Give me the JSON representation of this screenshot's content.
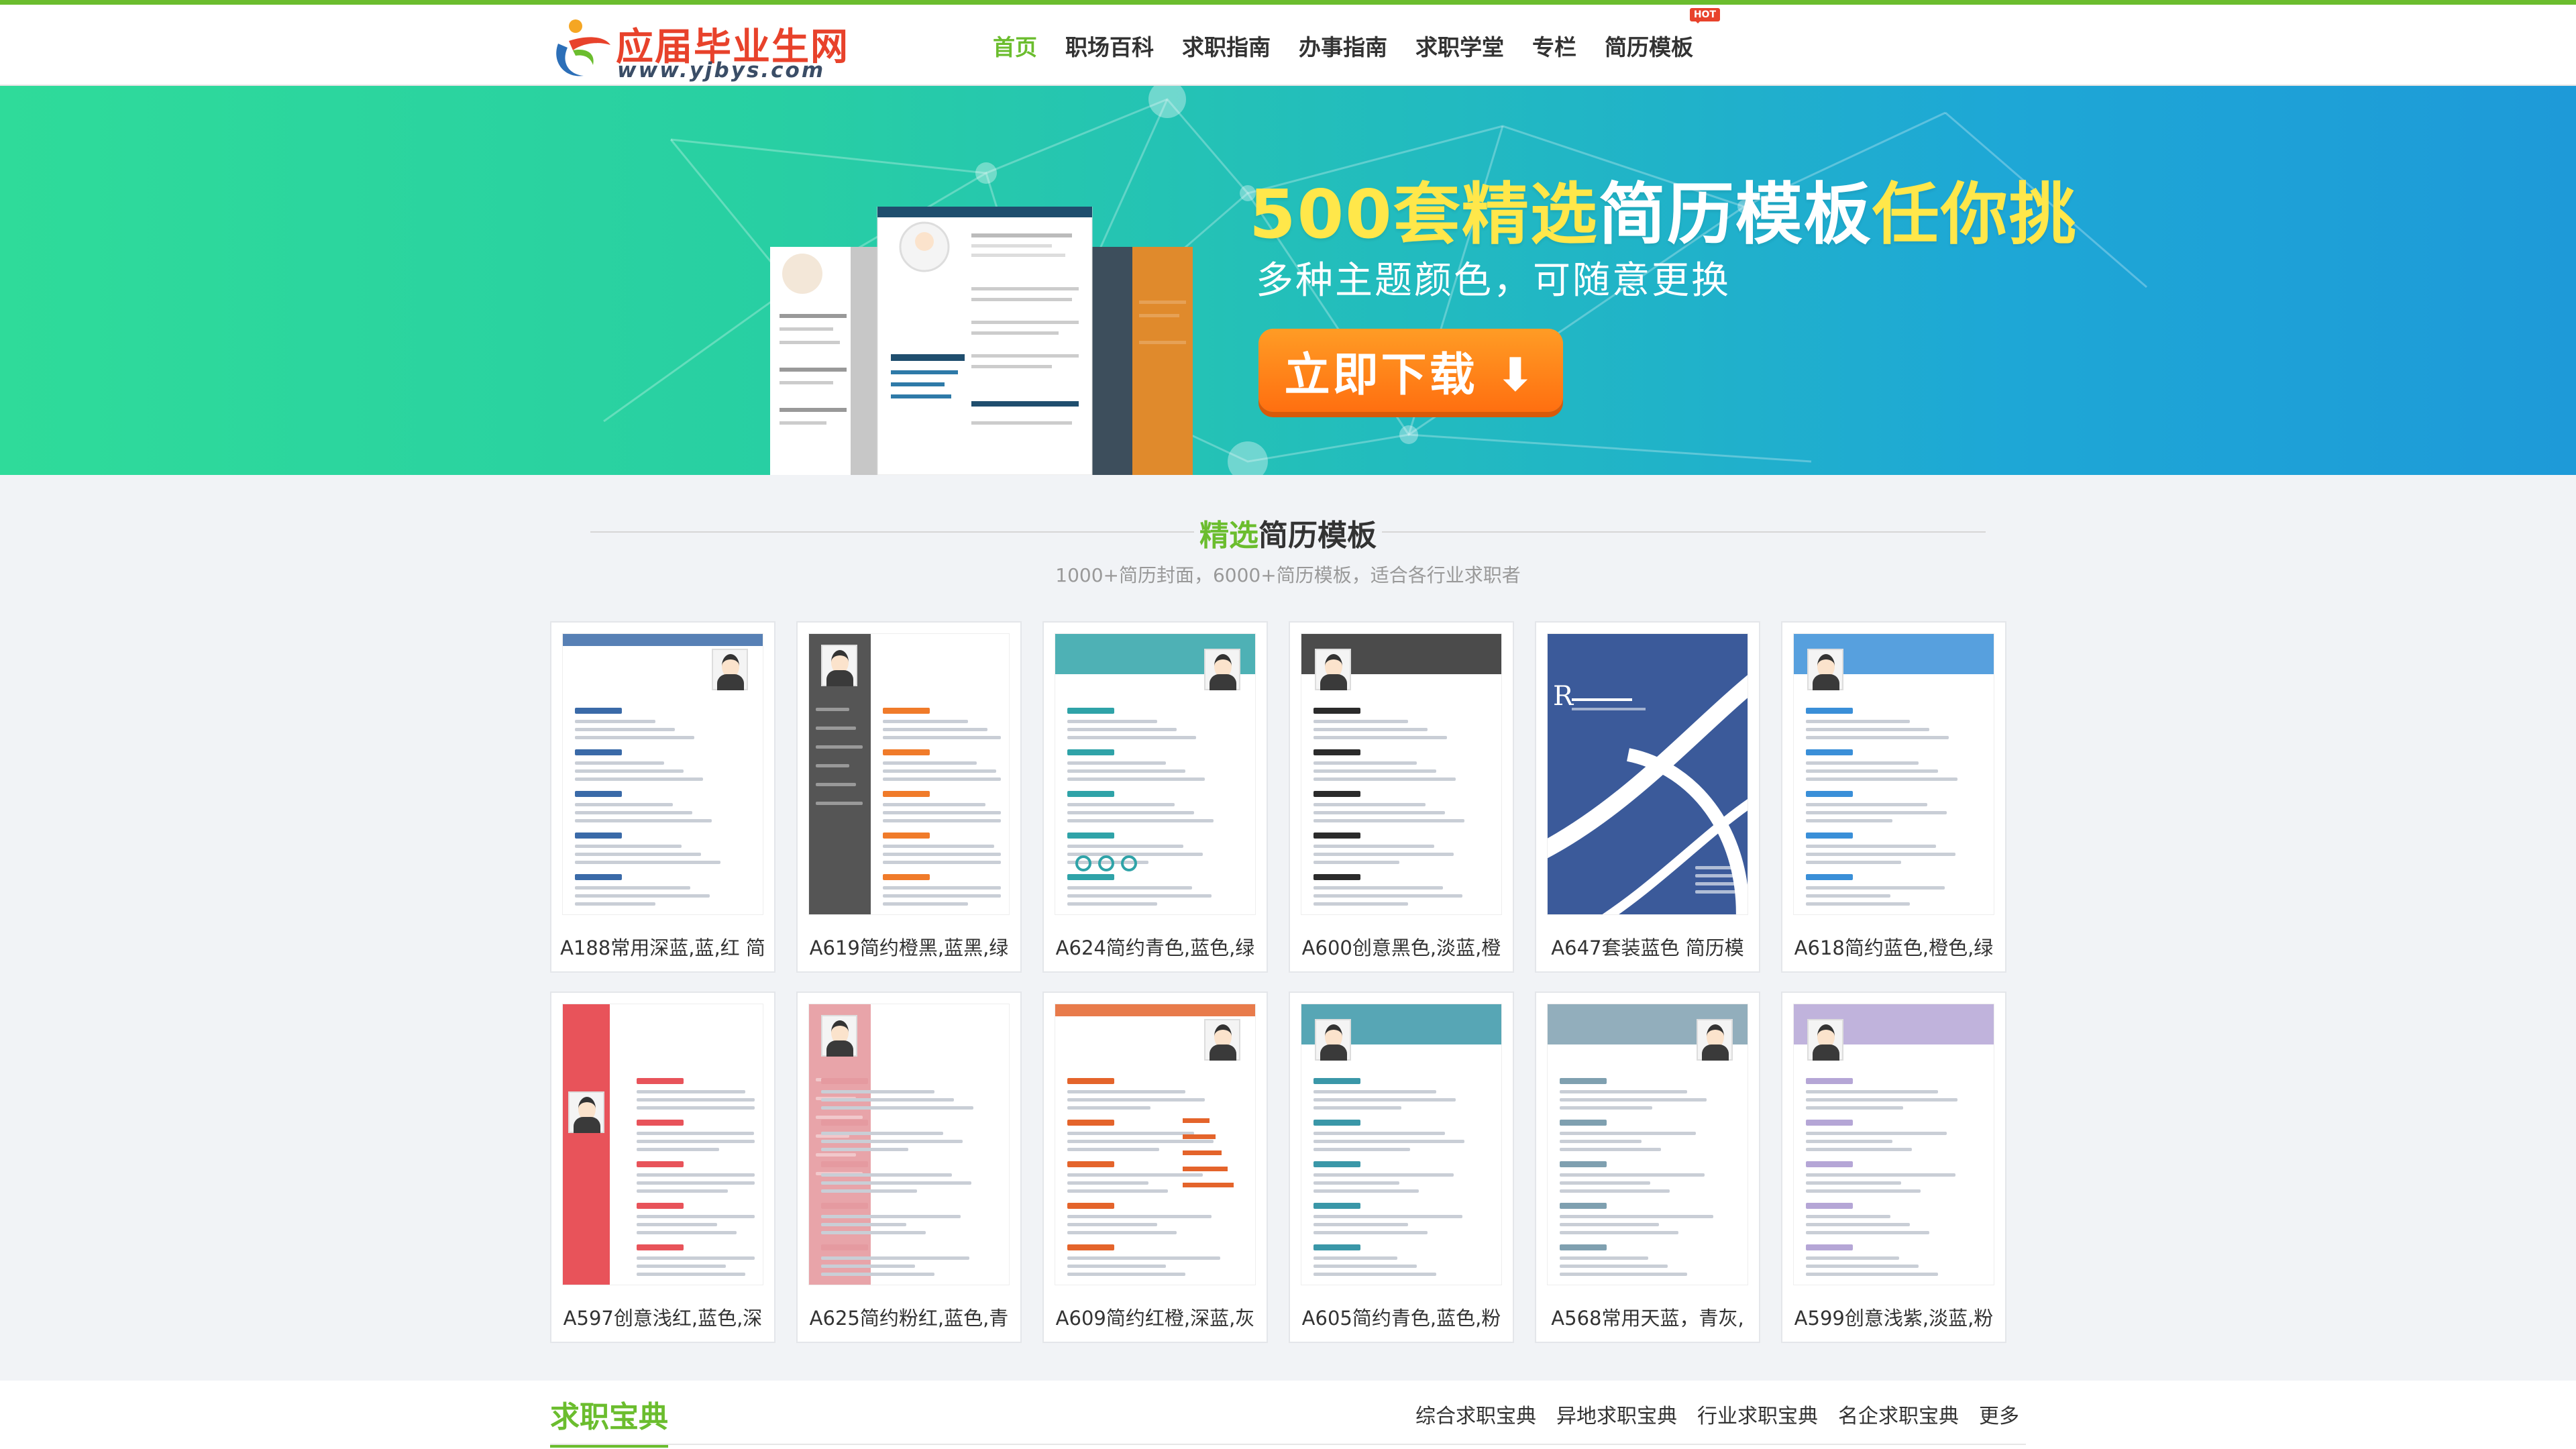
{
  "header": {
    "logo_name": "应届毕业生网",
    "logo_url": "www.yjbys.com",
    "nav": [
      {
        "label": "首页",
        "active": true
      },
      {
        "label": "职场百科"
      },
      {
        "label": "求职指南"
      },
      {
        "label": "办事指南"
      },
      {
        "label": "求职学堂"
      },
      {
        "label": "专栏"
      },
      {
        "label": "简历模板",
        "badge": "HOT"
      }
    ]
  },
  "banner": {
    "title_a": "500套精选",
    "title_b": "简历模板",
    "title_c": "任你挑",
    "subtitle": "多种主题颜色，可随意更换",
    "button": "立即下载 ⬇"
  },
  "templates_section": {
    "title_accent": "精选",
    "title_rest": "简历模板",
    "subtitle": "1000+简历封面，6000+简历模板，适合各行业求职者",
    "cards": [
      {
        "caption": "A188常用深蓝,蓝,红 简",
        "accent": "#3a6aa8"
      },
      {
        "caption": "A619简约橙黑,蓝黑,绿",
        "accent": "#f07b2a"
      },
      {
        "caption": "A624简约青色,蓝色,绿",
        "accent": "#2fa3a8"
      },
      {
        "caption": "A600创意黑色,淡蓝,橙",
        "accent": "#2b2b2b"
      },
      {
        "caption": "A647套装蓝色 简历模",
        "accent": "#3b5a9a"
      },
      {
        "caption": "A618简约蓝色,橙色,绿",
        "accent": "#3a8fd8"
      },
      {
        "caption": "A597创意浅红,蓝色,深",
        "accent": "#e8535a"
      },
      {
        "caption": "A625简约粉红,蓝色,青",
        "accent": "#e59aa0"
      },
      {
        "caption": "A609简约红橙,深蓝,灰",
        "accent": "#e4642b"
      },
      {
        "caption": "A605简约青色,蓝色,粉",
        "accent": "#3a97a8"
      },
      {
        "caption": "A568常用天蓝，青灰,",
        "accent": "#7fa0b0"
      },
      {
        "caption": "A599创意浅紫,淡蓝,粉",
        "accent": "#b5a6d6"
      }
    ]
  },
  "job_section": {
    "title": "求职宝典",
    "links": [
      "综合求职宝典",
      "异地求职宝典",
      "行业求职宝典",
      "名企求职宝典",
      "更多"
    ]
  }
}
